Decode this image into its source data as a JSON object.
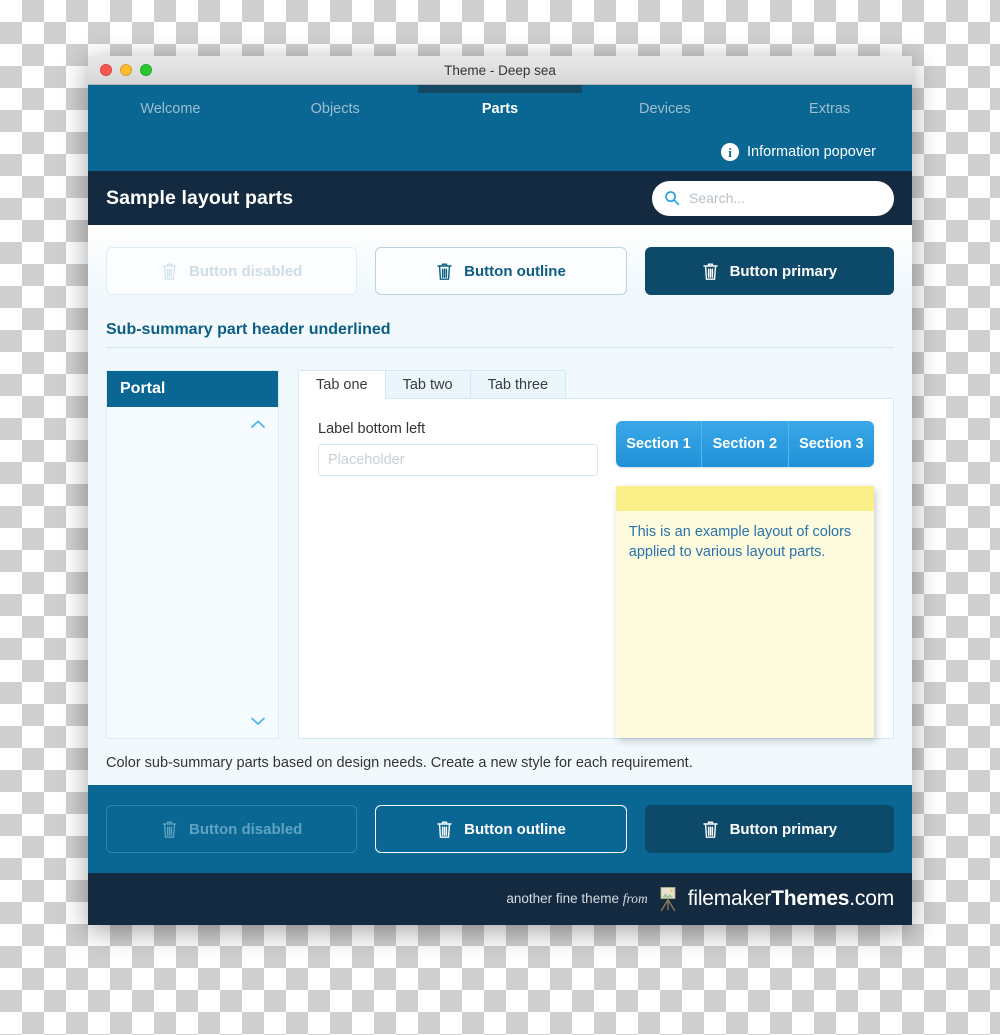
{
  "window": {
    "title": "Theme - Deep sea",
    "traffic_lights": [
      "close-red",
      "minimize-yellow",
      "zoom-green"
    ]
  },
  "navbar": {
    "tabs": [
      {
        "label": "Welcome",
        "active": false
      },
      {
        "label": "Objects",
        "active": false
      },
      {
        "label": "Parts",
        "active": true
      },
      {
        "label": "Devices",
        "active": false
      },
      {
        "label": "Extras",
        "active": false
      }
    ],
    "info_popover": {
      "icon": "info-circle-icon",
      "label": "Information popover"
    }
  },
  "header": {
    "title": "Sample layout parts",
    "search": {
      "icon": "search-icon",
      "placeholder": "Search..."
    }
  },
  "toolbar_top": {
    "buttons": [
      {
        "label": "Button disabled",
        "icon": "trash-icon",
        "style": "disabled"
      },
      {
        "label": "Button outline",
        "icon": "trash-icon",
        "style": "outline"
      },
      {
        "label": "Button primary",
        "icon": "trash-icon",
        "style": "primary"
      }
    ]
  },
  "subsummary": {
    "heading": "Sub-summary part header underlined"
  },
  "portal": {
    "title": "Portal",
    "scroll_up_icon": "chevron-up-icon",
    "scroll_down_icon": "chevron-down-icon"
  },
  "tabpanel": {
    "tabs": [
      {
        "label": "Tab one",
        "active": true
      },
      {
        "label": "Tab two",
        "active": false
      },
      {
        "label": "Tab three",
        "active": false
      }
    ],
    "field": {
      "label": "Label bottom left",
      "placeholder": "Placeholder",
      "value": ""
    },
    "segments": [
      {
        "label": "Section 1"
      },
      {
        "label": "Section 2"
      },
      {
        "label": "Section 3"
      }
    ],
    "note": {
      "text": "This is an example layout of colors applied to various layout parts."
    }
  },
  "caption": {
    "text": "Color sub-summary parts based on design needs. Create a new style for each requirement."
  },
  "toolbar_bottom": {
    "buttons": [
      {
        "label": "Button disabled",
        "icon": "trash-icon",
        "style": "disabled"
      },
      {
        "label": "Button outline",
        "icon": "trash-icon",
        "style": "outline"
      },
      {
        "label": "Button primary",
        "icon": "trash-icon",
        "style": "primary"
      }
    ]
  },
  "credits": {
    "prefix": "another fine theme ",
    "from": "from",
    "logo_icon": "easel-icon",
    "brand_light": "filemaker",
    "brand_bold": "Themes",
    "brand_tld": ".com"
  },
  "colors": {
    "nav_blue": "#0a6794",
    "dark_navy": "#132a40",
    "primary_button": "#0d4a69",
    "segment_blue": "#2192d8",
    "note_band": "#faf08a",
    "note_body": "#fdfbdd",
    "note_text": "#2a72ab",
    "heading_blue": "#0c5e84",
    "page_bg": "#f2f9fd"
  }
}
